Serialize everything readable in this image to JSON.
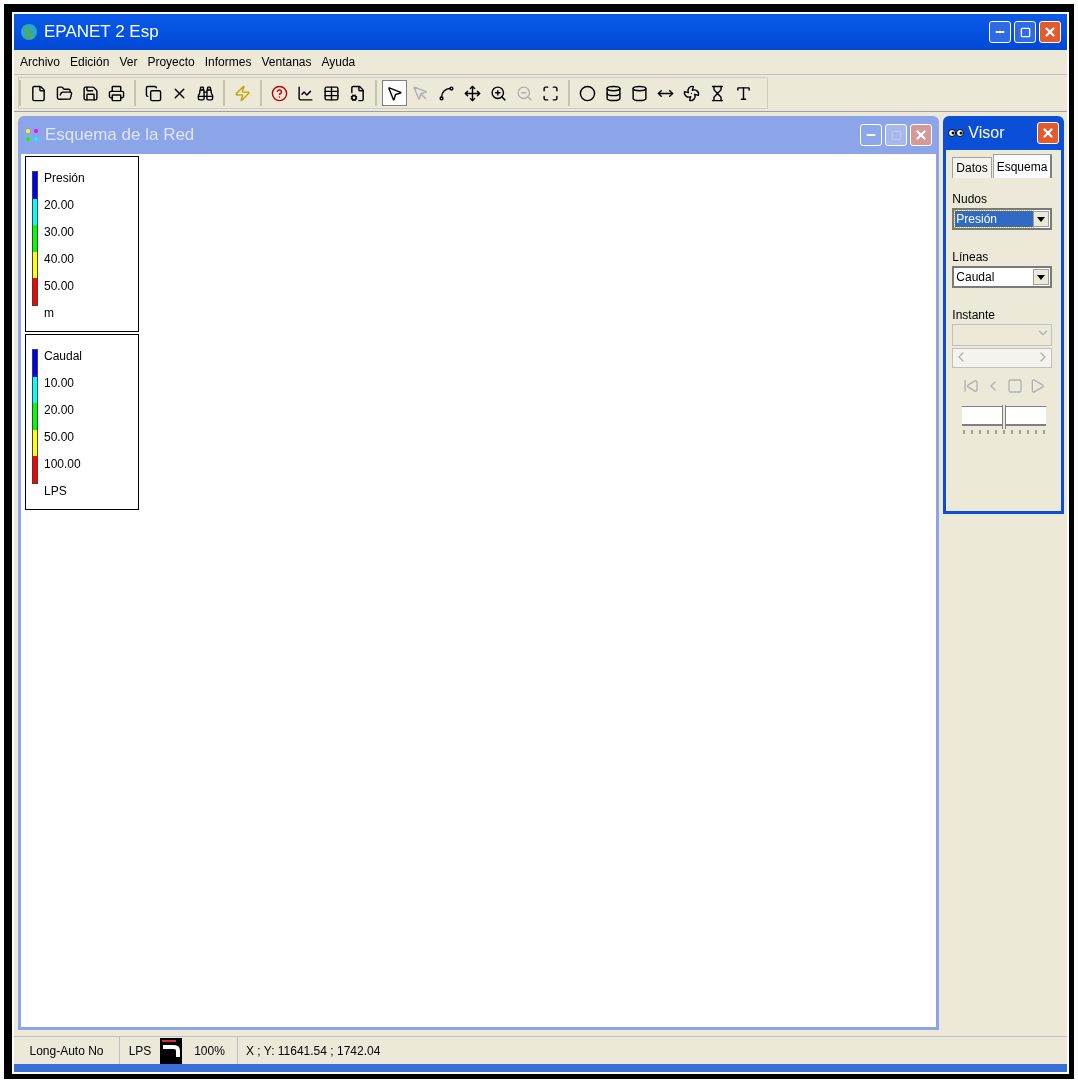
{
  "window": {
    "title": "EPANET 2 Esp"
  },
  "menu": [
    "Archivo",
    "Edición",
    "Ver",
    "Proyecto",
    "Informes",
    "Ventanas",
    "Ayuda"
  ],
  "toolbar": [
    [
      {
        "kind": "new",
        "disabled": false,
        "selected": false
      },
      {
        "kind": "open",
        "disabled": false,
        "selected": false
      },
      {
        "kind": "save",
        "disabled": false,
        "selected": false
      },
      {
        "kind": "print",
        "disabled": false,
        "selected": false
      }
    ],
    [
      {
        "kind": "copy",
        "disabled": false,
        "selected": false
      },
      {
        "kind": "delete",
        "disabled": false,
        "selected": false
      },
      {
        "kind": "find",
        "disabled": false,
        "selected": false
      }
    ],
    [
      {
        "kind": "run",
        "disabled": false,
        "selected": false
      }
    ],
    [
      {
        "kind": "query",
        "disabled": false,
        "selected": false
      },
      {
        "kind": "graph",
        "disabled": false,
        "selected": false
      },
      {
        "kind": "table",
        "disabled": false,
        "selected": false
      },
      {
        "kind": "options",
        "disabled": false,
        "selected": false
      }
    ],
    [
      {
        "kind": "select",
        "disabled": false,
        "selected": true
      },
      {
        "kind": "vertex",
        "disabled": true,
        "selected": false
      },
      {
        "kind": "region",
        "disabled": false,
        "selected": false
      },
      {
        "kind": "pan",
        "disabled": false,
        "selected": false
      },
      {
        "kind": "zoomin",
        "disabled": false,
        "selected": false
      },
      {
        "kind": "zoomout",
        "disabled": true,
        "selected": false
      },
      {
        "kind": "extent",
        "disabled": false,
        "selected": false
      }
    ],
    [
      {
        "kind": "junction",
        "disabled": false,
        "selected": false
      },
      {
        "kind": "reservoir",
        "disabled": false,
        "selected": false
      },
      {
        "kind": "tank",
        "disabled": false,
        "selected": false
      },
      {
        "kind": "pipe",
        "disabled": false,
        "selected": false
      },
      {
        "kind": "pump",
        "disabled": false,
        "selected": false
      },
      {
        "kind": "valve",
        "disabled": false,
        "selected": false
      },
      {
        "kind": "label",
        "disabled": false,
        "selected": false
      }
    ]
  ],
  "map_window": {
    "title": "Esquema de la Red",
    "legends": [
      {
        "title": "Presión",
        "ticks": [
          "20.00",
          "30.00",
          "40.00",
          "50.00"
        ],
        "unit": "m",
        "bands": [
          {
            "color": "#0000ff"
          },
          {
            "color": "#00ffff"
          },
          {
            "color": "#00ff00"
          },
          {
            "color": "#ffff00"
          },
          {
            "color": "#ff0000"
          }
        ]
      },
      {
        "title": "Caudal",
        "ticks": [
          "10.00",
          "20.00",
          "50.00",
          "100.00"
        ],
        "unit": "LPS",
        "bands": [
          {
            "color": "#0000ff"
          },
          {
            "color": "#00ffff"
          },
          {
            "color": "#00ff00"
          },
          {
            "color": "#ffff00"
          },
          {
            "color": "#ff0000"
          }
        ]
      }
    ]
  },
  "browser": {
    "title": "Visor",
    "tabs": [
      {
        "label": "Datos",
        "selected": false
      },
      {
        "label": "Esquema",
        "selected": true
      }
    ],
    "nodes": {
      "label": "Nudos",
      "value": "Presión",
      "focused": true
    },
    "links": {
      "label": "Líneas",
      "value": "Caudal",
      "focused": false
    },
    "time": {
      "label": "Instante",
      "disabled": true
    },
    "speed": {
      "level": 0.5
    }
  },
  "status_bar": {
    "auto_length": "Long-Auto No",
    "flow_units": "LPS",
    "zoom": "100%",
    "coordinates": "X ; Y: 11641.54 ; 1742.04"
  }
}
